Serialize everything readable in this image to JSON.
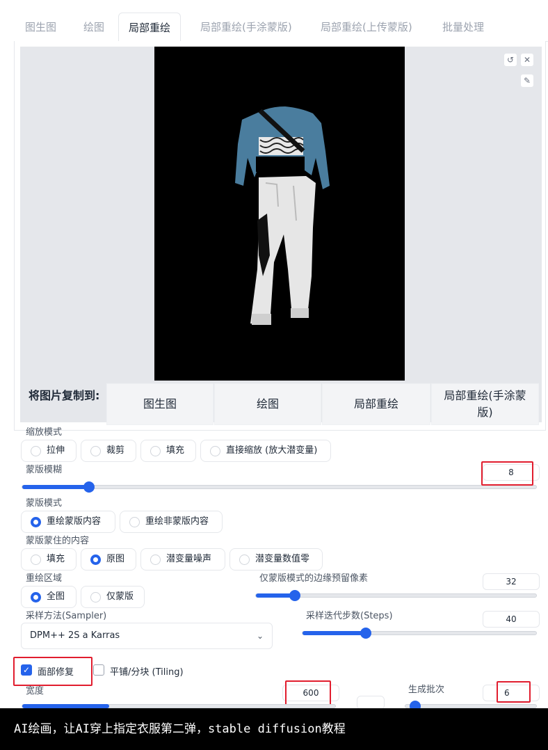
{
  "tabs": [
    {
      "label": "图生图"
    },
    {
      "label": "绘图"
    },
    {
      "label": "局部重绘"
    },
    {
      "label": "局部重绘(手涂蒙版)"
    },
    {
      "label": "局部重绘(上传蒙版)"
    },
    {
      "label": "批量处理"
    }
  ],
  "active_tab": "局部重绘",
  "canvas_tools": {
    "reset_icon": "undo-icon",
    "close_icon": "close-icon",
    "brush_icon": "brush-icon"
  },
  "copy_to": {
    "label": "将图片复制到:",
    "buttons": [
      "图生图",
      "绘图",
      "局部重绘",
      "局部重绘(手涂蒙\n版)"
    ]
  },
  "resize_mode": {
    "label": "缩放模式",
    "options": [
      "拉伸",
      "裁剪",
      "填充",
      "直接缩放 (放大潜变量)"
    ],
    "selected": null
  },
  "mask_blur": {
    "label": "蒙版模糊",
    "value": "8",
    "fraction": 0.13
  },
  "mask_mode": {
    "label": "蒙版模式",
    "options": [
      "重绘蒙版内容",
      "重绘非蒙版内容"
    ],
    "selected": "重绘蒙版内容"
  },
  "masked_content": {
    "label": "蒙版蒙住的内容",
    "options": [
      "填充",
      "原图",
      "潜变量噪声",
      "潜变量数值零"
    ],
    "selected": "原图"
  },
  "inpaint_area": {
    "label": "重绘区域",
    "options": [
      "全图",
      "仅蒙版"
    ],
    "selected": "全图"
  },
  "padding": {
    "label": "仅蒙版模式的边缘预留像素",
    "value": "32",
    "fraction": 0.14
  },
  "sampler": {
    "label": "采样方法(Sampler)",
    "value": "DPM++ 2S a Karras"
  },
  "steps": {
    "label": "采样迭代步数(Steps)",
    "value": "40",
    "fraction": 0.27
  },
  "face_restore": {
    "label": "面部修复",
    "checked": true
  },
  "tiling": {
    "label": "平铺/分块 (Tiling)",
    "checked": false
  },
  "width": {
    "label": "宽度",
    "value": "600"
  },
  "batch_count": {
    "label": "生成批次",
    "value": "6"
  },
  "accent": "#2563eb",
  "highlight": "#e11d2e",
  "caption": "AI绘画，让AI穿上指定衣服第二弹，stable diffusion教程"
}
